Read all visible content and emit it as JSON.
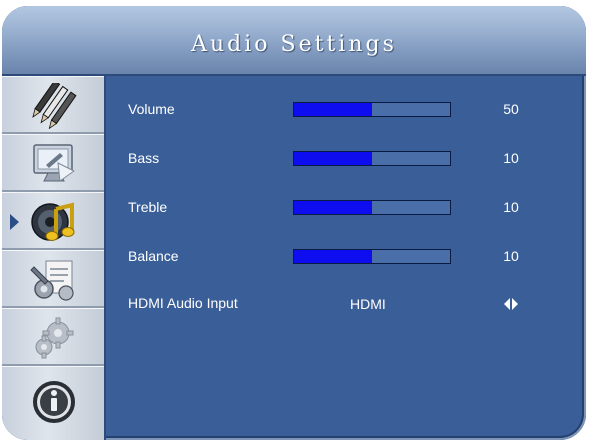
{
  "header": {
    "title": "Audio Settings"
  },
  "sidebar": {
    "items": [
      {
        "icon": "pencils-icon",
        "selected": false
      },
      {
        "icon": "monitor-icon",
        "selected": false
      },
      {
        "icon": "music-note-icon",
        "selected": true
      },
      {
        "icon": "tools-icon",
        "selected": false
      },
      {
        "icon": "gears-icon",
        "selected": false
      },
      {
        "icon": "info-icon",
        "selected": false
      }
    ]
  },
  "settings": {
    "volume": {
      "label": "Volume",
      "value": "50",
      "level": 0.5
    },
    "bass": {
      "label": "Bass",
      "value": "10",
      "level": 0.5
    },
    "treble": {
      "label": "Treble",
      "value": "10",
      "level": 0.5
    },
    "balance": {
      "label": "Balance",
      "value": "10",
      "level": 0.5
    },
    "hdmi_audio_input": {
      "label": "HDMI Audio Input",
      "value": "HDMI"
    }
  },
  "colors": {
    "background": "#3a5f98",
    "bar_fill": "#0d0df0",
    "text": "#ffffff"
  }
}
